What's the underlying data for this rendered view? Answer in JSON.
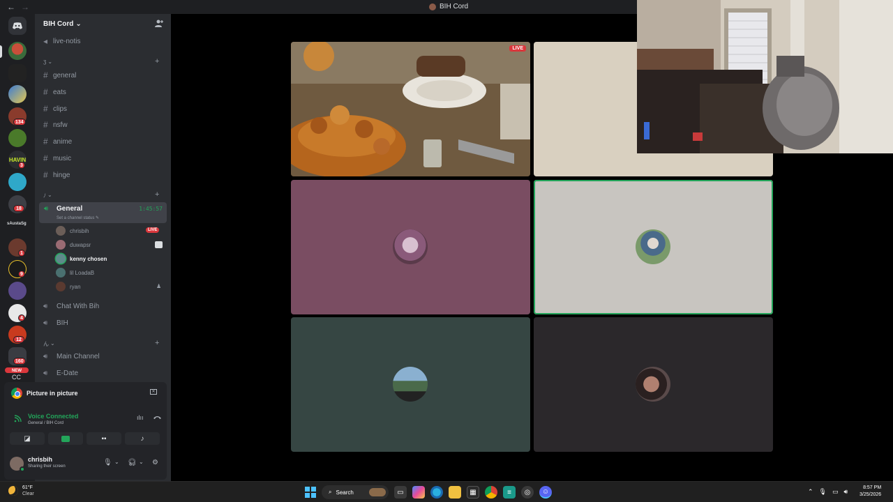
{
  "window": {
    "title": "BIH Cord",
    "back": "←",
    "forward": "→"
  },
  "server_list": {
    "home_icon": "discord-icon",
    "badges": [
      "134",
      "3",
      "18",
      "1",
      "9",
      "4",
      "12",
      "160",
      "NEW"
    ],
    "server_text_label": "sAustaSg",
    "bottom_label": "CC"
  },
  "guild": {
    "name": "BIH Cord",
    "chevron": "⌄",
    "top_channel": "live-notis",
    "category1": "ʒ",
    "text_channels": [
      "general",
      "eats",
      "clips",
      "nsfw",
      "anime",
      "music",
      "hinge"
    ],
    "category2": "ﾉ",
    "voice_channel": {
      "name": "General",
      "timer": "1:45:57",
      "status": "Set a channel status",
      "users": [
        {
          "name": "chrisbih",
          "badge": "LIVE"
        },
        {
          "name": "duwapsr"
        },
        {
          "name": "kenny chosen"
        },
        {
          "name": "lil LoadaB"
        },
        {
          "name": "ryan"
        }
      ]
    },
    "other_voice": [
      "Chat With Bih",
      "BIH"
    ],
    "category3": "ん",
    "more_voice": [
      "Main Channel",
      "E-Date"
    ]
  },
  "pip_panel": {
    "title": "Picture in picture",
    "voice_status": "Voice Connected",
    "voice_location": "General / BIH Cord",
    "user": {
      "name": "chrisbih",
      "status": "Sharing their screen"
    }
  },
  "stage": {
    "live_label": "LIVE",
    "tile_colors": [
      "#d9d0c0",
      "#7a4d62",
      "#c8c5c0",
      "#364643",
      "#2b282b"
    ]
  },
  "taskbar": {
    "temperature": "61°F",
    "condition": "Clear",
    "search_label": "Search",
    "time": "8:57 PM",
    "date": "3/25/2026"
  }
}
